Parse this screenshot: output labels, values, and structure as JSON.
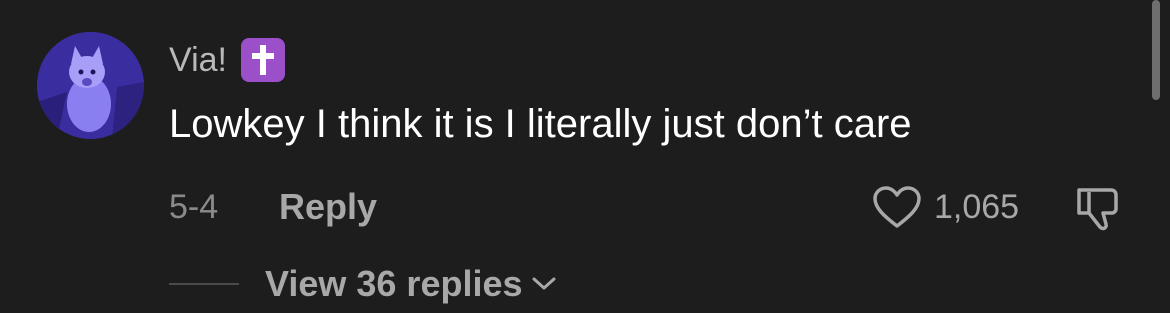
{
  "comment": {
    "username": "Via!",
    "username_emoji": "latin-cross-emoji",
    "text": "Lowkey I think it is I literally just don’t care",
    "date": "5-4",
    "reply_label": "Reply",
    "like_count": "1,065",
    "view_replies_label": "View 36 replies"
  },
  "icons": {
    "like": "heart-outline-icon",
    "dislike": "thumbs-down-icon",
    "expand": "chevron-down-icon"
  },
  "colors": {
    "background": "#1d1d1d",
    "text_primary": "#ffffff",
    "text_secondary": "#a8a8a8",
    "emoji_bg": "#9b4fc9"
  }
}
